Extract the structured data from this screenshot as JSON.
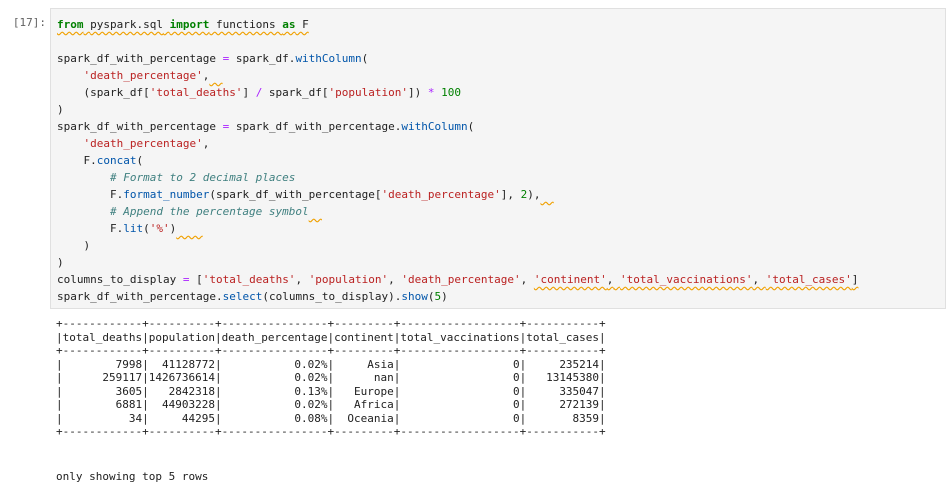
{
  "cell": {
    "prompt": "[17]:",
    "code_lines": [
      [
        {
          "t": "from",
          "c": "kw",
          "sq": true
        },
        {
          "t": " ",
          "c": "p",
          "sq": true
        },
        {
          "t": "pyspark.sql",
          "c": "p",
          "sq": true
        },
        {
          "t": " ",
          "c": "p",
          "sq": true
        },
        {
          "t": "import",
          "c": "kw",
          "sq": true
        },
        {
          "t": " functions ",
          "c": "p",
          "sq": true
        },
        {
          "t": "as",
          "c": "kw",
          "sq": true
        },
        {
          "t": " F",
          "c": "p",
          "sq": true
        }
      ],
      [
        {
          "t": "",
          "c": "p"
        }
      ],
      [
        {
          "t": "spark_df_with_percentage ",
          "c": "p"
        },
        {
          "t": "=",
          "c": "op"
        },
        {
          "t": " spark_df.",
          "c": "p"
        },
        {
          "t": "withColumn",
          "c": "fn"
        },
        {
          "t": "(",
          "c": "p"
        }
      ],
      [
        {
          "t": "    ",
          "c": "p"
        },
        {
          "t": "'death_percentage'",
          "c": "str"
        },
        {
          "t": ",",
          "c": "p"
        },
        {
          "t": "  ",
          "c": "p",
          "sq": true
        }
      ],
      [
        {
          "t": "    (spark_df[",
          "c": "p"
        },
        {
          "t": "'total_deaths'",
          "c": "str"
        },
        {
          "t": "] ",
          "c": "p"
        },
        {
          "t": "/",
          "c": "op"
        },
        {
          "t": " spark_df[",
          "c": "p"
        },
        {
          "t": "'population'",
          "c": "str"
        },
        {
          "t": "]) ",
          "c": "p"
        },
        {
          "t": "*",
          "c": "op"
        },
        {
          "t": " ",
          "c": "p"
        },
        {
          "t": "100",
          "c": "num"
        }
      ],
      [
        {
          "t": ")",
          "c": "p"
        }
      ],
      [
        {
          "t": "spark_df_with_percentage ",
          "c": "p"
        },
        {
          "t": "=",
          "c": "op"
        },
        {
          "t": " spark_df_with_percentage.",
          "c": "p"
        },
        {
          "t": "withColumn",
          "c": "fn"
        },
        {
          "t": "(",
          "c": "p"
        }
      ],
      [
        {
          "t": "    ",
          "c": "p"
        },
        {
          "t": "'death_percentage'",
          "c": "str"
        },
        {
          "t": ",",
          "c": "p"
        }
      ],
      [
        {
          "t": "    F.",
          "c": "p"
        },
        {
          "t": "concat",
          "c": "fn"
        },
        {
          "t": "(",
          "c": "p"
        }
      ],
      [
        {
          "t": "        ",
          "c": "p"
        },
        {
          "t": "# Format to 2 decimal places",
          "c": "cm"
        }
      ],
      [
        {
          "t": "        F.",
          "c": "p"
        },
        {
          "t": "format_number",
          "c": "fn"
        },
        {
          "t": "(spark_df_with_percentage[",
          "c": "p"
        },
        {
          "t": "'death_percentage'",
          "c": "str"
        },
        {
          "t": "], ",
          "c": "p"
        },
        {
          "t": "2",
          "c": "num"
        },
        {
          "t": "),",
          "c": "p"
        },
        {
          "t": "  ",
          "c": "p",
          "sq": true
        }
      ],
      [
        {
          "t": "        ",
          "c": "p"
        },
        {
          "t": "# Append the percentage symbol",
          "c": "cm"
        },
        {
          "t": "  ",
          "c": "p",
          "sq": true
        }
      ],
      [
        {
          "t": "        F.",
          "c": "p"
        },
        {
          "t": "lit",
          "c": "fn"
        },
        {
          "t": "(",
          "c": "p"
        },
        {
          "t": "'%'",
          "c": "str"
        },
        {
          "t": ")",
          "c": "p"
        },
        {
          "t": "    ",
          "c": "p",
          "sq": true
        }
      ],
      [
        {
          "t": "    )",
          "c": "p"
        }
      ],
      [
        {
          "t": ")",
          "c": "p"
        }
      ],
      [
        {
          "t": "columns_to_display ",
          "c": "p"
        },
        {
          "t": "=",
          "c": "op"
        },
        {
          "t": " [",
          "c": "p"
        },
        {
          "t": "'total_deaths'",
          "c": "str"
        },
        {
          "t": ", ",
          "c": "p"
        },
        {
          "t": "'population'",
          "c": "str"
        },
        {
          "t": ", ",
          "c": "p"
        },
        {
          "t": "'death_percentage'",
          "c": "str"
        },
        {
          "t": ", ",
          "c": "p"
        },
        {
          "t": "'continent'",
          "c": "str",
          "sq": true
        },
        {
          "t": ", ",
          "c": "p",
          "sq": true
        },
        {
          "t": "'total_vaccinations'",
          "c": "str",
          "sq": true
        },
        {
          "t": ", ",
          "c": "p",
          "sq": true
        },
        {
          "t": "'total_cases'",
          "c": "str",
          "sq": true
        },
        {
          "t": "]",
          "c": "p",
          "sq": true
        }
      ],
      [
        {
          "t": "spark_df_with_percentage.",
          "c": "p"
        },
        {
          "t": "select",
          "c": "fn"
        },
        {
          "t": "(columns_to_display).",
          "c": "p"
        },
        {
          "t": "show",
          "c": "fn"
        },
        {
          "t": "(",
          "c": "p"
        },
        {
          "t": "5",
          "c": "num"
        },
        {
          "t": ")",
          "c": "p"
        }
      ]
    ],
    "output_lines": [
      "+------------+----------+----------------+---------+------------------+-----------+",
      "|total_deaths|population|death_percentage|continent|total_vaccinations|total_cases|",
      "+------------+----------+----------------+---------+------------------+-----------+",
      "|        7998|  41128772|           0.02%|     Asia|                 0|     235214|",
      "|      259117|1426736614|           0.02%|      nan|                 0|   13145380|",
      "|        3605|   2842318|           0.13%|   Europe|                 0|     335047|",
      "|        6881|  44903228|           0.02%|   Africa|                 0|     272139|",
      "|          34|     44295|           0.08%|  Oceania|                 0|       8359|",
      "+------------+----------+----------------+---------+------------------+-----------+"
    ],
    "output_footer": "only showing top 5 rows"
  },
  "colors": {
    "keyword": "#008000",
    "string": "#ba2121",
    "comment": "#408080",
    "function": "#0055aa",
    "operator": "#aa22ff",
    "squiggle": "#f0a000",
    "input_bg": "#f5f5f5",
    "prompt": "#616161"
  }
}
